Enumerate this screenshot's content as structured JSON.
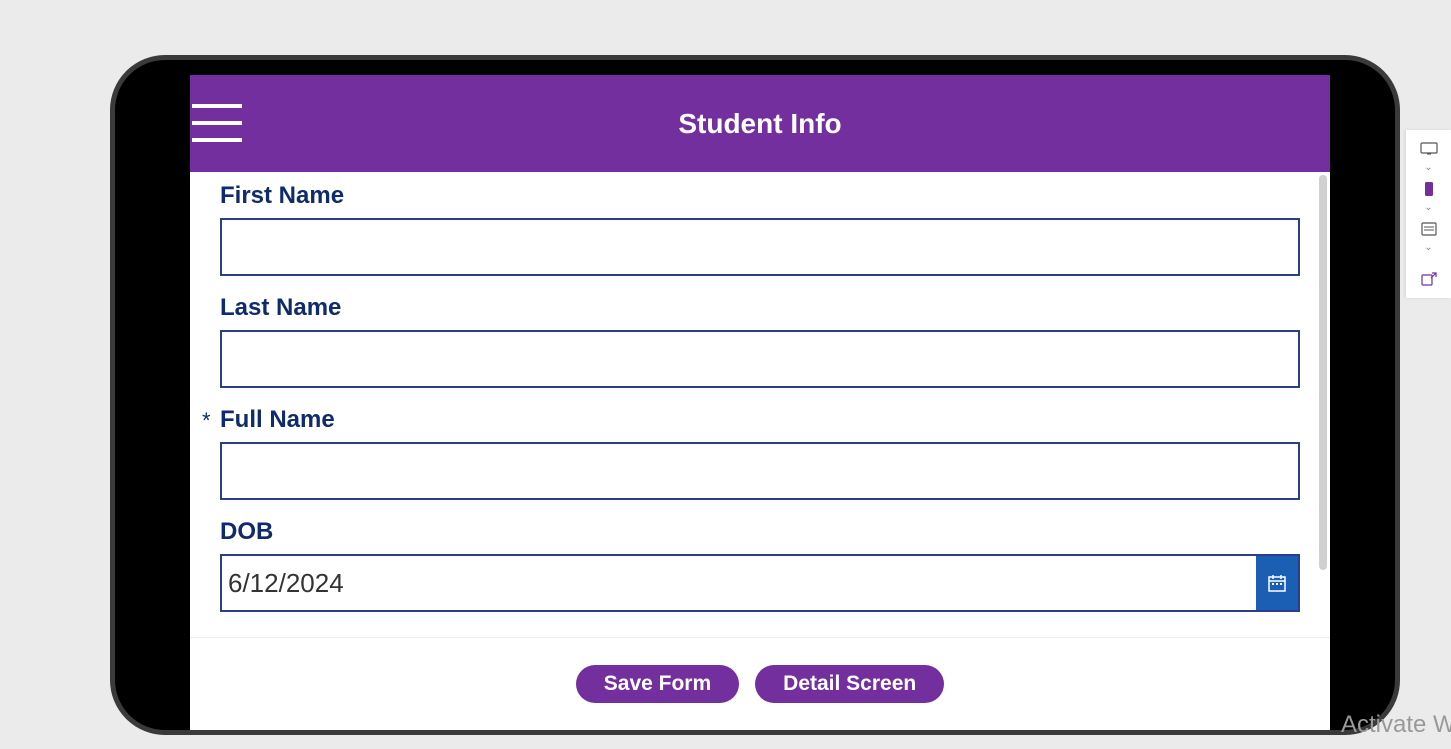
{
  "header": {
    "title": "Student Info"
  },
  "form": {
    "first_name": {
      "label": "First Name",
      "value": ""
    },
    "last_name": {
      "label": "Last Name",
      "value": ""
    },
    "full_name": {
      "label": "Full Name",
      "value": "",
      "required_marker": "*"
    },
    "dob": {
      "label": "DOB",
      "value": "6/12/2024"
    }
  },
  "footer": {
    "save_label": "Save Form",
    "detail_label": "Detail Screen"
  },
  "watermark": "Activate Wi"
}
